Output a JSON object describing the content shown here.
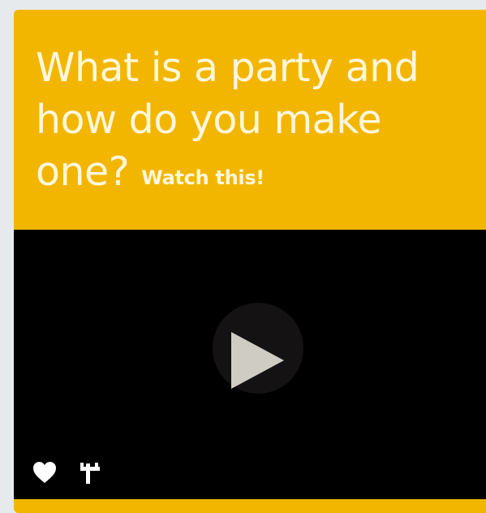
{
  "card": {
    "title": "What is a party and how do you make one?",
    "cta": "Watch this!",
    "colors": {
      "background": "#f2b600",
      "title_text": "#fff7dc",
      "video": "#000000",
      "play_button": "#141212",
      "play_glyph": "#cfccc4",
      "action_icons": "#ffffff"
    }
  },
  "video": {
    "play_icon": "play-icon"
  },
  "actions": [
    {
      "icon": "heart-icon"
    },
    {
      "icon": "share-icon"
    }
  ]
}
